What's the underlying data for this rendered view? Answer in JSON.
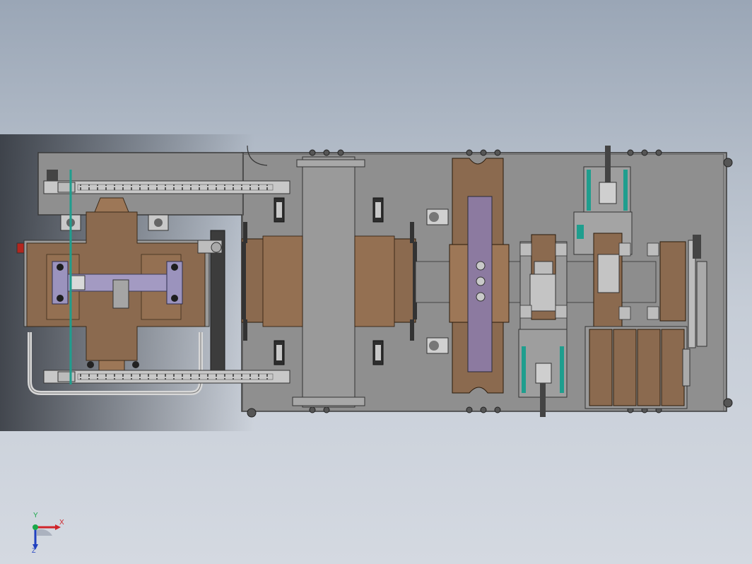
{
  "app": {
    "view": "top",
    "colors": {
      "background_top": "#9aa6b6",
      "background_bottom": "#d4d9e1",
      "frame": "#8f8f8f",
      "cardboard": "#8b6a4f",
      "cardboard_light": "#9d7757",
      "pusher": "#8c7aa0",
      "guide_rail": "#1f9e8e",
      "steel_dark": "#2f2f2f"
    }
  },
  "triad": {
    "x_label": "X",
    "y_label": "Y",
    "z_label": "Z",
    "icon": "coordinate-triad-icon"
  },
  "stations": [
    {
      "id": "folding-station",
      "icon": "carton-folding-icon"
    },
    {
      "id": "conveyor-bridge",
      "icon": "conveyor-bridge-icon"
    },
    {
      "id": "forming-station",
      "icon": "carton-forming-icon"
    },
    {
      "id": "pusher-station",
      "icon": "pusher-icon"
    },
    {
      "id": "gluing-station",
      "icon": "glue-unit-icon"
    },
    {
      "id": "stacking-station",
      "icon": "stacker-icon"
    }
  ]
}
